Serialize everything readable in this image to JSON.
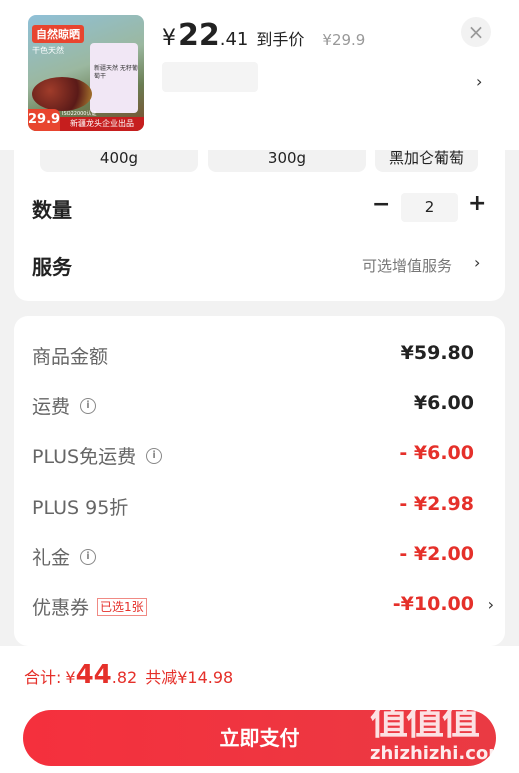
{
  "product": {
    "image_badge": "自然晾晒",
    "image_badge_sub": "干色天然",
    "image_pack_text": "新疆天然 无籽葡萄干",
    "image_price": "29.9",
    "image_cert": "ISO22000认证",
    "image_brand": "新疆龙头企业出品",
    "price_symbol": "¥",
    "price_int": "22",
    "price_dec": ".41",
    "arrive_label": "到手价",
    "original_price": "¥29.9",
    "close_icon": "×",
    "chevron": "›"
  },
  "spec_chips": [
    "400g",
    "300g",
    "黑加仑葡萄"
  ],
  "quantity": {
    "label": "数量",
    "minus": "−",
    "value": "2",
    "plus": "+"
  },
  "service": {
    "label": "服务",
    "value": "可选增值服务",
    "chevron": "›"
  },
  "fees": [
    {
      "label": "商品金额",
      "value": "¥59.80",
      "info": false,
      "red": false
    },
    {
      "label": "运费",
      "value": "¥6.00",
      "info": true,
      "red": false
    },
    {
      "label": "PLUS免运费",
      "value": "- ¥6.00",
      "info": true,
      "red": true
    },
    {
      "label": "PLUS 95折",
      "value": "- ¥2.98",
      "info": false,
      "red": true
    },
    {
      "label": "礼金",
      "value": "- ¥2.00",
      "info": true,
      "red": true
    },
    {
      "label": "优惠券",
      "tag": "已选1张",
      "value": "-¥10.00",
      "info": false,
      "red": true,
      "chevron": "›"
    }
  ],
  "total": {
    "label": "合计:",
    "symbol": "¥",
    "int": "44",
    "dec": ".82",
    "saved": "共减¥14.98"
  },
  "pay_button": "立即支付",
  "watermark": {
    "logo": "值值值",
    "text": "zhizhizhi.com"
  },
  "colors": {
    "accent": "#e5302a",
    "button": "#f5303d"
  }
}
